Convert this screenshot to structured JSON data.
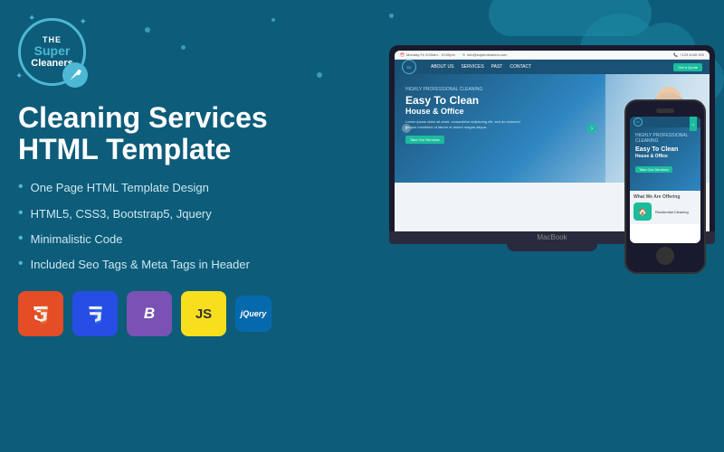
{
  "brand": {
    "the": "THE",
    "super": "Super",
    "cleaners": "Cleaners",
    "logoAlt": "Super Cleaners Logo"
  },
  "heading": {
    "line1": "Cleaning Services",
    "line2": "HTML Template"
  },
  "features": [
    "One Page HTML Template Design",
    "HTML5, CSS3, Bootstrap5, Jquery",
    "Minimalistic Code",
    "Included Seo Tags & Meta Tags in Header"
  ],
  "badges": [
    {
      "label": "HTML5",
      "type": "html"
    },
    {
      "label": "CSS3",
      "type": "css"
    },
    {
      "label": "Bootstrap",
      "type": "bs"
    },
    {
      "label": "JS",
      "type": "js"
    },
    {
      "label": "jQuery",
      "type": "jquery"
    }
  ],
  "preview": {
    "nav_items": [
      "ABOUT US",
      "SERVICES",
      "PAST",
      "CONTACT"
    ],
    "hero_label": "HIGHLY PROFESSIONAL CLEANING",
    "hero_title": "Easy To Clean",
    "hero_subtitle": "House & Office",
    "hero_body": "Lorem ipsum dolor sit amet, consectetur adipiscing elit, sed do eiusmod tempor incididunt ut labore et dolore magna aliqua.",
    "hero_cta": "Take Our Services",
    "quote_btn": "Get a Quote",
    "contact1": "Monday-Fri 8:00am - 10:00pm",
    "contact2": "info@supercleaners.com",
    "contact3": "+123 4440 000",
    "services_title": "What We Are Offering",
    "service1": "Residential Cleaning"
  },
  "colors": {
    "bg": "#0d5c7a",
    "accent": "#1abc9c",
    "nav": "#1a5276",
    "text_light": "#cce8f0"
  }
}
